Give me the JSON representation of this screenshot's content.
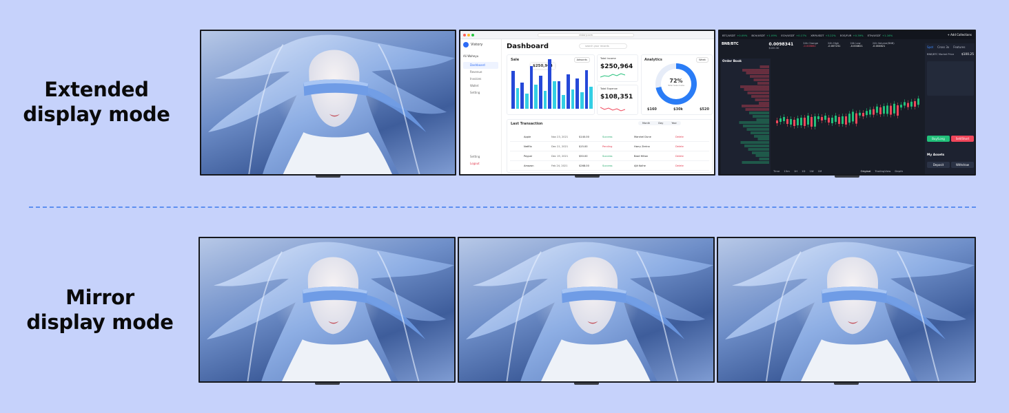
{
  "labels": {
    "extended_line1": "Extended",
    "extended_line2": "display mode",
    "mirror_line1": "Mirror",
    "mirror_line2": "display mode"
  },
  "dashboard": {
    "app_name": "Vistory",
    "url": "vistory.com",
    "title": "Dashboard",
    "search_placeholder": "search your records",
    "user_name": "Ali Waheyu",
    "nav_items": [
      "Dashboard",
      "Revenue",
      "Invoices",
      "Wallet",
      "Setting"
    ],
    "footer_nav": [
      "Setting",
      "Logout"
    ],
    "sale_label": "Sale",
    "sale_value": "$250,964",
    "chart_filter": "Adwords",
    "total_income_label": "Total Income",
    "total_income_value": "$250,964",
    "total_expense_label": "Total Expense",
    "total_expense_value": "$108,351",
    "analytics_label": "Analytics",
    "analytics_range": "Week",
    "donut_value": "72%",
    "donut_caption": "Total Sale made",
    "analytics_stats": [
      "$160",
      "$30k",
      "$520"
    ],
    "transactions_title": "Last Transaction",
    "transactions_tabs": [
      "Month",
      "Day",
      "Year"
    ],
    "transactions": [
      {
        "brand": "Apple",
        "date": "Nov 23, 2021",
        "amount": "$140.00",
        "status": "Success",
        "person": "Marshel Dune",
        "action": "Delete"
      },
      {
        "brand": "Netflix",
        "date": "Dec 21, 2021",
        "amount": "$15.00",
        "status": "Pending",
        "person": "Harry Zerina",
        "action": "Delete"
      },
      {
        "brand": "Paypal",
        "date": "Dec 19, 2021",
        "amount": "$50.00",
        "status": "Success",
        "person": "Basil Hilton",
        "action": "Delete"
      },
      {
        "brand": "Amazon",
        "date": "Feb 24, 2021",
        "amount": "$268.00",
        "status": "Success",
        "person": "Ajit Kolhe",
        "action": "Delete"
      }
    ],
    "chart_data": {
      "type": "bar",
      "series": [
        {
          "values": [
            55,
            38,
            62,
            48,
            72,
            40,
            50,
            44,
            56
          ]
        },
        {
          "values": [
            30,
            22,
            35,
            26,
            40,
            20,
            28,
            24,
            32
          ]
        }
      ]
    }
  },
  "trading": {
    "tickers": [
      {
        "pair": "BTC/USDT",
        "change": "+0.09%"
      },
      {
        "pair": "BCH/USDT",
        "change": "+1.09%"
      },
      {
        "pair": "ECH/USDT",
        "change": "+0.17%"
      },
      {
        "pair": "XRP/USDT",
        "change": "+3.22%"
      },
      {
        "pair": "EOS/FUR",
        "change": "+0.39%"
      },
      {
        "pair": "ETH/USDT",
        "change": "+1.16%"
      }
    ],
    "add_collections": "+ Add Collections",
    "pair": "BNB/BTC",
    "price": "0.0098341",
    "price_sub": "$100.30",
    "change_label": "24h Change",
    "change_value": "-0.008862",
    "high_label": "24h High",
    "high_value": "-0.007231",
    "low_label": "24h Low",
    "low_value": "-0.004621",
    "volume_label": "24h Volume(BNB)",
    "volume_value": "-0.004621",
    "order_book": "Order Book",
    "tabs": [
      "Spot",
      "Cross 3x",
      "Features"
    ],
    "time_options": [
      "Time",
      "15m",
      "1H",
      "1D",
      "1W",
      "1M"
    ],
    "views": [
      "Original",
      "TradingView",
      "Depth"
    ],
    "buy_label": "Buy/Long",
    "sell_label": "Sell/Short",
    "assets_title": "My Assets",
    "deposit": "Deposit",
    "withdraw": "Withdraw",
    "market_price_label": "BNB/BTC Market Price",
    "market_price_value": "$100.25"
  }
}
